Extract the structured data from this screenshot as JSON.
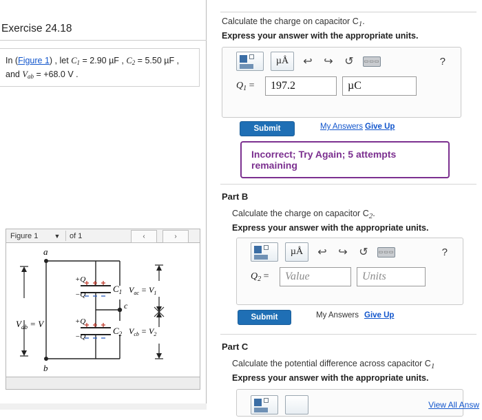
{
  "left": {
    "exercise_title": "Exercise 24.18",
    "problem": {
      "prefix": "In (",
      "figure_link": "Figure 1",
      "mid": ") , let ",
      "c1": "C",
      "c1_sub": "1",
      "c1_val": " = 2.90  µF ,",
      "c2": "C",
      "c2_sub": "2",
      "c2_val": " = 5.50  µF ,",
      "line2_prefix": "and ",
      "vab": "V",
      "vab_sub": "ab",
      "vab_val": " = +68.0  V ."
    },
    "figure_widget": {
      "label": "Figure 1",
      "dropdown_caret": "▼",
      "of_label": "of 1",
      "prev_icon": "‹",
      "next_icon": "›"
    },
    "figure_diagram": {
      "node_a": "a",
      "node_b": "b",
      "node_c": "c",
      "vab_label": "V",
      "vab_sub": "ab",
      "vab_eq": " = V",
      "cap1_label": "C",
      "cap1_sub": "1",
      "cap2_label": "C",
      "cap2_sub": "2",
      "vac_label": "V",
      "vac_sub": "ac",
      "vac_eq": " = V",
      "vac_eq_sub": "1",
      "vcb_label": "V",
      "vcb_sub": "cb",
      "vcb_eq": " = V",
      "vcb_eq_sub": "2",
      "charge_plus": "+Q",
      "charge_minus": "−Q"
    }
  },
  "right": {
    "part_a": {
      "question": "Calculate the charge on capacitor C",
      "question_sub": "1",
      "question_end": ".",
      "instruction": "Express your answer with the appropriate units.",
      "toolbar": {
        "matrix_icon": "matrix-icon",
        "units_icon": "µÅ",
        "undo_icon": "↩",
        "redo_icon": "↪",
        "reset_icon": "↺",
        "keyboard_icon": "keyboard-icon",
        "help_icon": "?"
      },
      "answer_label": "Q",
      "answer_label_sub": "1",
      "answer_label_eq": " =",
      "value": "197.2",
      "units": "µC",
      "submit_label": "Submit",
      "my_answers_label": "My Answers",
      "give_up_label": "Give Up",
      "feedback": "Incorrect; Try Again; 5 attempts remaining"
    },
    "part_b": {
      "heading": "Part B",
      "question": "Calculate the charge on capacitor C",
      "question_sub": "2",
      "question_end": ".",
      "instruction": "Express your answer with the appropriate units.",
      "toolbar": {
        "units_icon": "µÅ",
        "undo_icon": "↩",
        "redo_icon": "↪",
        "reset_icon": "↺",
        "help_icon": "?"
      },
      "answer_label": "Q",
      "answer_label_sub": "2",
      "answer_label_eq": " =",
      "value_placeholder": "Value",
      "units_placeholder": "Units",
      "submit_label": "Submit",
      "my_answers_label": "My Answers",
      "give_up_label": "Give Up"
    },
    "part_c": {
      "heading": "Part C",
      "question": "Calculate the potential difference across capacitor C",
      "question_sub": "1",
      "instruction": "Express your answer with the appropriate units."
    },
    "footer_link": "View All Answ"
  },
  "colors": {
    "submit_blue": "#1f6fb5",
    "link_blue": "#1155cc",
    "feedback_purple": "#7b2f8f"
  }
}
